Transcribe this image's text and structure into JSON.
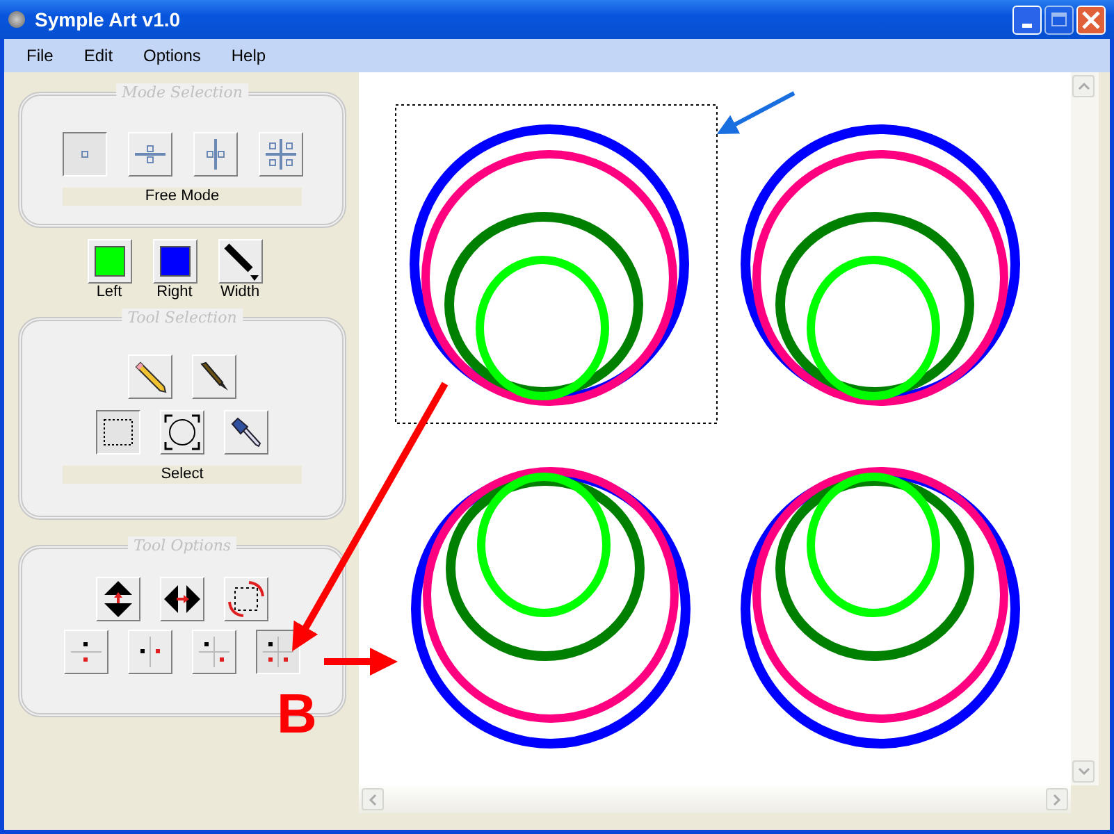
{
  "window": {
    "title": "Symple Art v1.0"
  },
  "menu": [
    "File",
    "Edit",
    "Options",
    "Help"
  ],
  "mode_selection": {
    "title": "Mode Selection",
    "modes": [
      {
        "kind": "free",
        "selected": true
      },
      {
        "kind": "horizontal",
        "selected": false
      },
      {
        "kind": "vertical",
        "selected": false
      },
      {
        "kind": "quad",
        "selected": false
      }
    ],
    "label": "Free Mode"
  },
  "colors": [
    {
      "kind": "swatch",
      "label": "Left",
      "color": "#00ff00"
    },
    {
      "kind": "swatch",
      "label": "Right",
      "color": "#0000ff"
    },
    {
      "kind": "width",
      "label": "Width"
    }
  ],
  "tool_selection": {
    "title": "Tool Selection",
    "tools": [
      {
        "kind": "pencil",
        "selected": false
      },
      {
        "kind": "brush",
        "selected": false
      },
      {
        "kind": "rect-select",
        "selected": true
      },
      {
        "kind": "ellipse-select",
        "selected": false
      },
      {
        "kind": "dropper",
        "selected": false
      }
    ],
    "label": "Select"
  },
  "tool_options": {
    "title": "Tool Options",
    "buttons": [
      {
        "kind": "flip-vertical",
        "selected": false
      },
      {
        "kind": "flip-horizontal",
        "selected": false
      },
      {
        "kind": "rotate",
        "selected": false
      },
      {
        "kind": "mirror-down",
        "selected": false
      },
      {
        "kind": "mirror-right",
        "selected": false
      },
      {
        "kind": "mirror-corner",
        "selected": false
      },
      {
        "kind": "mirror-all",
        "selected": true
      }
    ]
  },
  "annotation": {
    "letter": "B"
  }
}
